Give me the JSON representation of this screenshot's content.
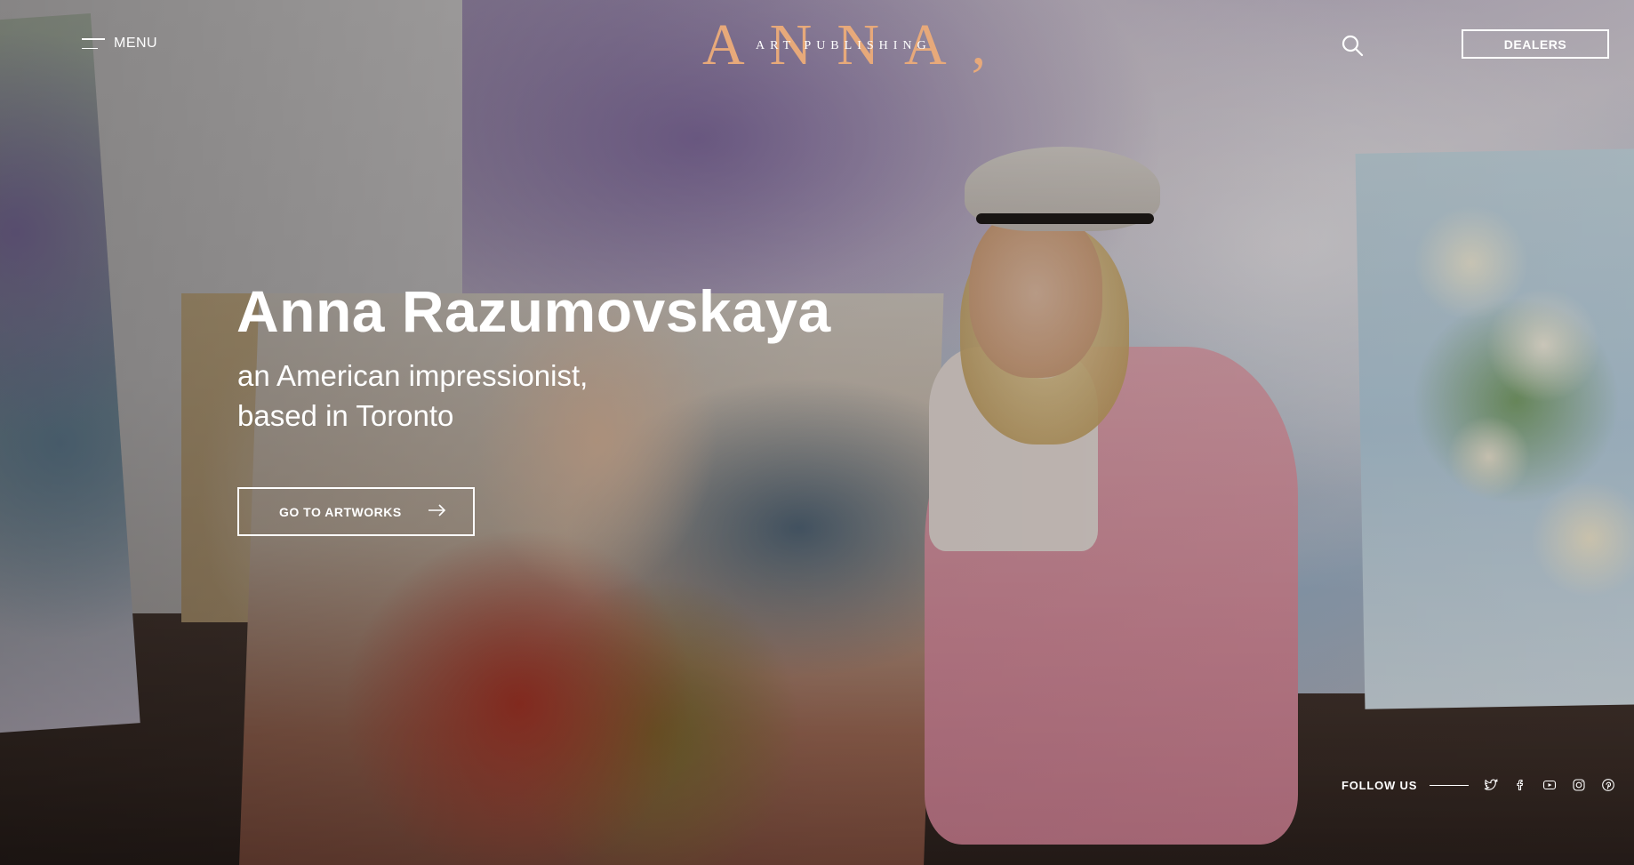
{
  "header": {
    "menu_label": "MENU",
    "logo_main": "ANNA,",
    "logo_sub": "ART PUBLISHING",
    "dealers_label": "DEALERS"
  },
  "hero": {
    "title": "Anna Razumovskaya",
    "subtitle_line1": "an American impressionist,",
    "subtitle_line2": "based in Toronto",
    "cta_label": "GO TO ARTWORKS"
  },
  "footer": {
    "follow_label": "FOLLOW US",
    "social_icons": [
      "twitter-icon",
      "facebook-icon",
      "youtube-icon",
      "instagram-icon",
      "pinterest-icon"
    ]
  },
  "colors": {
    "logo_accent": "#e7a97a",
    "text": "#ffffff"
  }
}
